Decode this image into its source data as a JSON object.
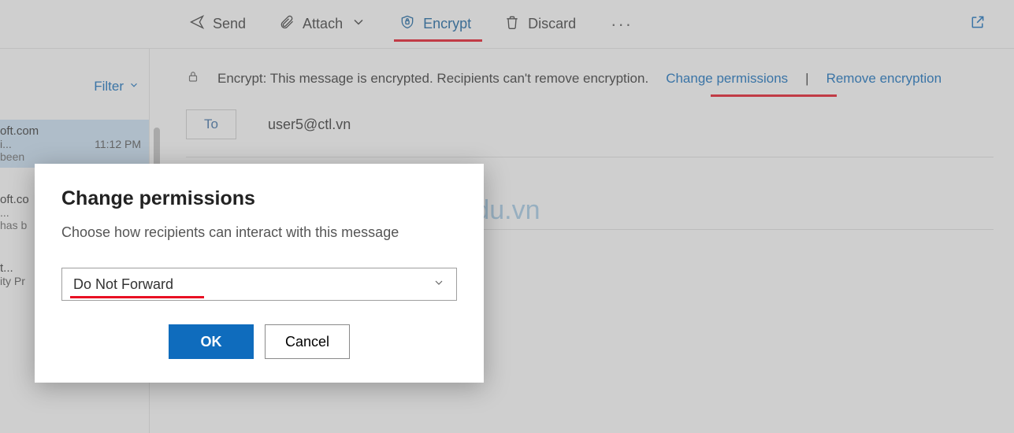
{
  "toolbar": {
    "send": "Send",
    "attach": "Attach",
    "encrypt": "Encrypt",
    "discard": "Discard"
  },
  "sidebar": {
    "filter": "Filter",
    "items": [
      {
        "from": "oft.com",
        "subject": "i...",
        "time": "11:12 PM",
        "preview": "been"
      },
      {
        "from": "oft.co",
        "subject": "...",
        "time": "",
        "preview": "has b"
      },
      {
        "from": "t...",
        "subject": "ity Pr",
        "time": "",
        "preview": ""
      }
    ]
  },
  "compose": {
    "info_prefix": "Encrypt: This message is encrypted. Recipients can't remove encryption.",
    "change_permissions": "Change permissions",
    "remove_encryption": "Remove encryption",
    "to_label": "To",
    "to_value": "user5@ctl.vn"
  },
  "dialog": {
    "title": "Change permissions",
    "description": "Choose how recipients can interact with this message",
    "selected_option": "Do Not Forward",
    "ok": "OK",
    "cancel": "Cancel"
  },
  "watermark": "ctl.edu.vn"
}
